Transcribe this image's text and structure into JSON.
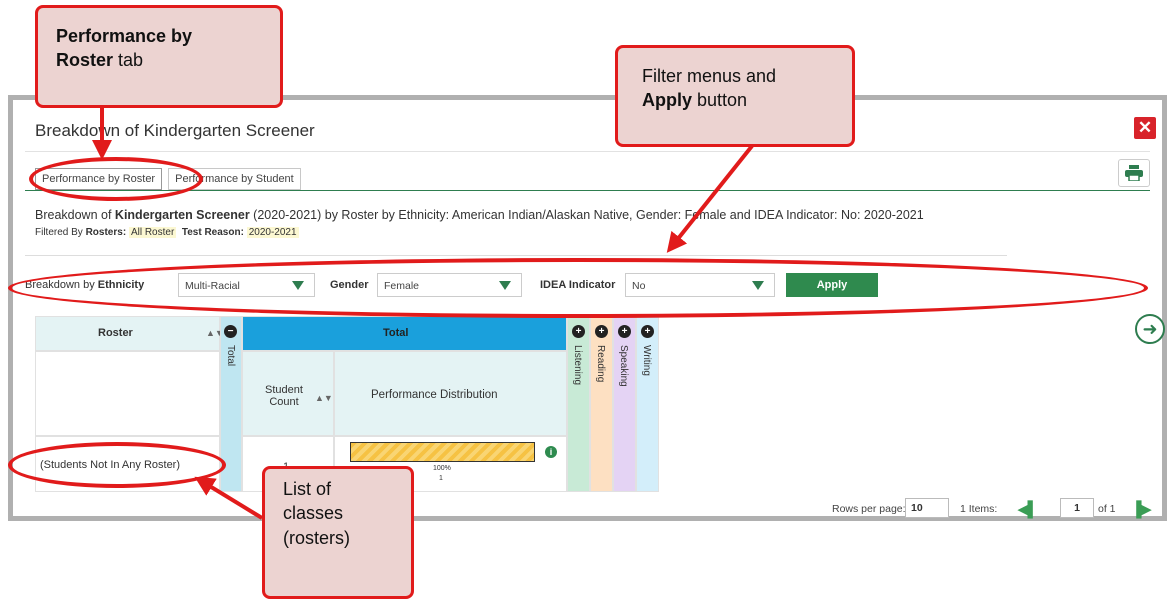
{
  "dialog": {
    "title": "Breakdown of Kindergarten Screener",
    "tabs": [
      {
        "label": "Performance by Roster",
        "active": true
      },
      {
        "label": "Performance by Student",
        "active": false
      }
    ],
    "breakdown_prefix": "Breakdown of ",
    "breakdown_bold": "Kindergarten Screener",
    "breakdown_rest": " (2020-2021) by Roster by Ethnicity: American Indian/Alaskan Native, Gender: Female and IDEA Indicator: No: 2020-2021",
    "filtered_by_label": "Filtered By ",
    "rosters_label": "Rosters:",
    "rosters_value": "All Roster",
    "test_reason_label": "Test Reason:",
    "test_reason_value": "2020-2021",
    "icons": {
      "close": "close-icon",
      "print": "print-icon"
    }
  },
  "filters": {
    "breakdown_prefix": "Breakdown by ",
    "ethnicity_label": "Ethnicity",
    "ethnicity_value": "Multi-Racial",
    "gender_label": "Gender",
    "gender_value": "Female",
    "idea_label": "IDEA Indicator",
    "idea_value": "No",
    "apply_label": "Apply",
    "accent": "#2f8a4e"
  },
  "table": {
    "roster_header": "Roster",
    "total_col": "Total",
    "total_group": "Total",
    "student_count_header": "Student Count",
    "performance_header": "Performance Distribution",
    "domain_cols": [
      {
        "label": "Listening",
        "color": "#c8ead6"
      },
      {
        "label": "Reading",
        "color": "#fde0c2"
      },
      {
        "label": "Speaking",
        "color": "#e4d3f4"
      },
      {
        "label": "Writing",
        "color": "#d3eefa"
      }
    ],
    "rows": [
      {
        "roster": "(Students Not In Any Roster)",
        "student_count": "1",
        "bar_percent_label": "100%",
        "bar_count": "1",
        "bar_fraction": 1.0
      }
    ],
    "info_icon": "info-icon",
    "header_color": "#1aa0dc"
  },
  "pagination": {
    "rows_per_page_label": "Rows per page:",
    "rows_per_page_value": "10",
    "items_label": "1 Items:",
    "page_value": "1",
    "of_label": "of 1"
  },
  "callouts": {
    "roster_tab_bold1": "Performance by",
    "roster_tab_bold2": "Roster",
    "roster_tab_rest": " tab",
    "filters_line1": "Filter menus and",
    "filters_bold": "Apply",
    "filters_rest": " button",
    "classes_line1": "List of",
    "classes_line2": "classes",
    "classes_line3": "(rosters)"
  }
}
